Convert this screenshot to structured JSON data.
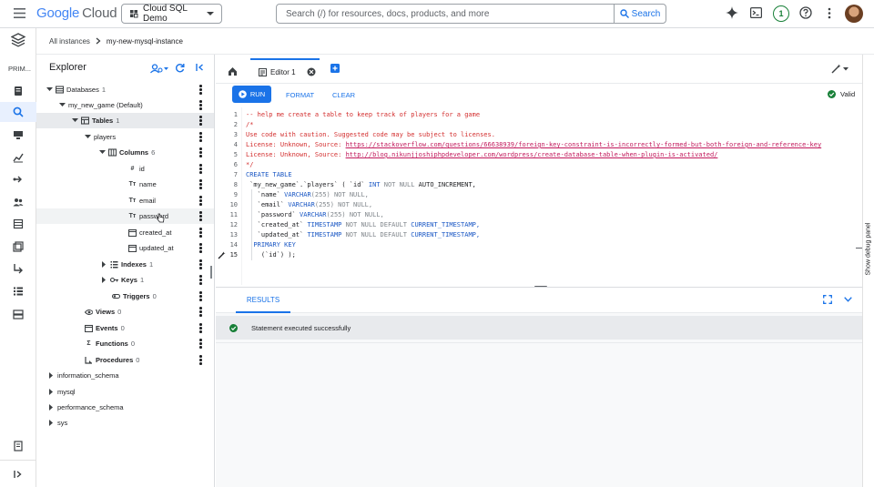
{
  "topbar": {
    "logo_google": "Google",
    "logo_cloud": "Cloud",
    "project": "Cloud SQL Demo",
    "search_placeholder": "Search (/) for resources, docs, products, and more",
    "search_button": "Search",
    "notifications_count": "1",
    "colors": {
      "accent": "#1a73e8",
      "green": "#188038"
    }
  },
  "rail": {
    "label": "PRIM..."
  },
  "breadcrumb": {
    "root": "All instances",
    "current": "my-new-mysql-instance"
  },
  "explorer": {
    "title": "Explorer",
    "tree": {
      "databases": {
        "label": "Databases",
        "count": "1"
      },
      "db": {
        "label": "my_new_game (Default)"
      },
      "tables": {
        "label": "Tables",
        "count": "1"
      },
      "table": {
        "label": "players"
      },
      "columns": {
        "label": "Columns",
        "count": "6"
      },
      "cols": [
        "id",
        "name",
        "email",
        "password",
        "created_at",
        "updated_at"
      ],
      "indexes": {
        "label": "Indexes",
        "count": "1"
      },
      "keys": {
        "label": "Keys",
        "count": "1"
      },
      "triggers": {
        "label": "Triggers",
        "count": "0"
      },
      "views": {
        "label": "Views",
        "count": "0"
      },
      "events": {
        "label": "Events",
        "count": "0"
      },
      "functions": {
        "label": "Functions",
        "count": "0"
      },
      "procedures": {
        "label": "Procedures",
        "count": "0"
      },
      "other_dbs": [
        "information_schema",
        "mysql",
        "performance_schema",
        "sys"
      ]
    }
  },
  "editor": {
    "tab_label": "Editor 1",
    "run": "RUN",
    "format": "FORMAT",
    "clear": "CLEAR",
    "status": "Valid",
    "line_numbers": [
      "1",
      "2",
      "3",
      "4",
      "5",
      "6",
      "7",
      "8",
      "9",
      "10",
      "11",
      "12",
      "13",
      "14",
      "15"
    ],
    "code": {
      "l1": "-- help me create a table to keep track of players for a game",
      "l2": "/*",
      "l3": "Use code with caution. Suggested code may be subject to licenses.",
      "l4_prefix": "License: Unknown, Source: ",
      "l4_url": "https://stackoverflow.com/questions/66638939/foreign-key-constraint-is-incorrectly-formed-but-both-foreign-and-reference-key",
      "l5_prefix": "License: Unknown, Source: ",
      "l5_url": "http://blog.nikunjjoshiphpdeveloper.com/wordpress/create-database-table-when-plugin-is-activated/",
      "l6": "*/",
      "l7": "CREATE TABLE",
      "l8_a": " `my_new_game`.`players` ( `id` ",
      "l8_b": "INT",
      "l8_c": " NOT NULL ",
      "l8_d": "AUTO_INCREMENT,",
      "l9_a": "   `name` ",
      "l9_b": "VARCHAR",
      "l9_c": "(255)",
      "l9_d": " NOT NULL,",
      "l10_a": "   `email` ",
      "l10_b": "VARCHAR",
      "l10_c": "(255)",
      "l10_d": " NOT NULL,",
      "l11_a": "   `password` ",
      "l11_b": "VARCHAR",
      "l11_c": "(255)",
      "l11_d": " NOT NULL,",
      "l12_a": "   `created_at` ",
      "l12_b": "TIMESTAMP",
      "l12_c": " NOT NULL DEFAULT ",
      "l12_d": "CURRENT_TIMESTAMP,",
      "l13_a": "   `updated_at` ",
      "l13_b": "TIMESTAMP",
      "l13_c": " NOT NULL DEFAULT ",
      "l13_d": "CURRENT_TIMESTAMP,",
      "l14": "  PRIMARY KEY",
      "l15": "    (`id`) );"
    }
  },
  "results": {
    "tab": "RESULTS",
    "message": "Statement executed successfully"
  },
  "debug_panel": {
    "label": "Show debug panel"
  }
}
